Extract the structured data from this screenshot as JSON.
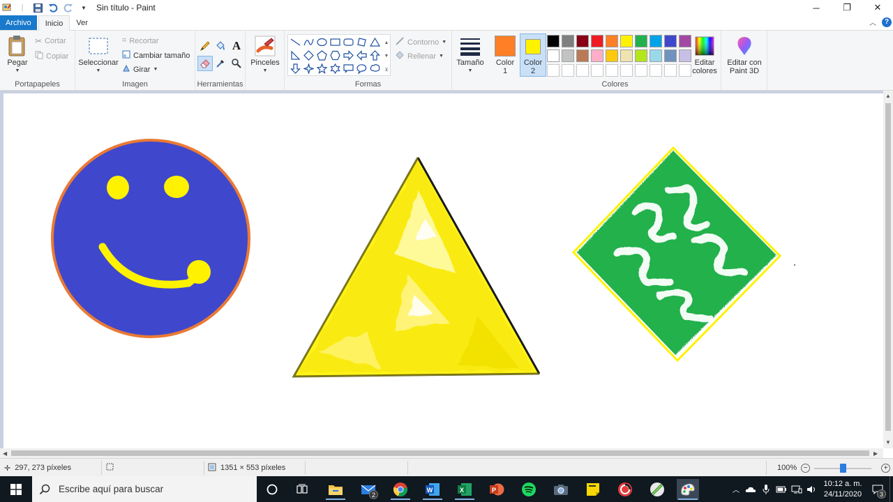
{
  "window": {
    "title": "Sin título - Paint"
  },
  "tabs": [
    {
      "label": "Archivo"
    },
    {
      "label": "Inicio"
    },
    {
      "label": "Ver"
    }
  ],
  "ribbon": {
    "portapapeles": {
      "label": "Portapapeles",
      "pegar": "Pegar",
      "cortar": "Cortar",
      "copiar": "Copiar"
    },
    "imagen": {
      "label": "Imagen",
      "seleccionar": "Seleccionar",
      "recortar": "Recortar",
      "cambiar_tamano": "Cambiar tamaño",
      "girar": "Girar"
    },
    "herramientas": {
      "label": "Herramientas"
    },
    "pinceles": {
      "label": "Pinceles"
    },
    "formas": {
      "label": "Formas",
      "contorno": "Contorno",
      "rellenar": "Rellenar"
    },
    "tamano": {
      "label": "Tamaño"
    },
    "colores": {
      "label": "Colores",
      "color1_label": "Color\n1",
      "color1_a": "Color",
      "color1_b": "1",
      "color2_a": "Color",
      "color2_b": "2",
      "color1": "#ff7f27",
      "color2": "#fff200",
      "editar_a": "Editar",
      "editar_b": "colores",
      "paint3d_a": "Editar con",
      "paint3d_b": "Paint 3D",
      "palette_row1": [
        "#000000",
        "#7f7f7f",
        "#880015",
        "#ed1c24",
        "#ff7f27",
        "#fff200",
        "#22b14c",
        "#00a2e8",
        "#3f48cc",
        "#a349a4"
      ],
      "palette_row2": [
        "#ffffff",
        "#c3c3c3",
        "#b97a57",
        "#ffaec9",
        "#ffc90e",
        "#efe4b0",
        "#b5e61d",
        "#99d9ea",
        "#7092be",
        "#c8bfe7"
      ]
    }
  },
  "canvas": {
    "circle_fill": "#3f48cc",
    "circle_outline": "#ea7a35",
    "face_color": "#fff200",
    "triangle_color": "#fff200",
    "triangle_outline": "#1a1a1a",
    "diamond_fill": "#22b14c",
    "diamond_outline": "#fff200"
  },
  "status": {
    "cursor": "297, 273 píxeles",
    "size": "1351 × 553 píxeles",
    "zoom": "100%",
    "zoom_level": 0.5
  },
  "taskbar": {
    "search_placeholder": "Escribe aquí para buscar",
    "mail_badge": "2",
    "time": "10:12 a. m.",
    "date": "24/11/2020",
    "notif_badge": "3"
  }
}
